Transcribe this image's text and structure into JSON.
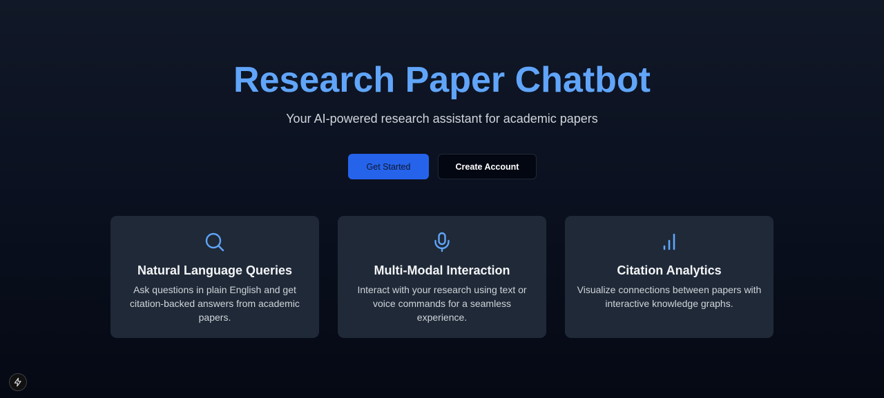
{
  "hero": {
    "title": "Research Paper Chatbot",
    "subtitle": "Your AI-powered research assistant for academic papers"
  },
  "actions": {
    "primary_label": "Get Started",
    "secondary_label": "Create Account"
  },
  "features": [
    {
      "icon": "search-icon",
      "title": "Natural Language Queries",
      "description": "Ask questions in plain English and get citation-backed answers from academic papers."
    },
    {
      "icon": "microphone-icon",
      "title": "Multi-Modal Interaction",
      "description": "Interact with your research using text or voice commands for a seamless experience."
    },
    {
      "icon": "bar-chart-icon",
      "title": "Citation Analytics",
      "description": "Visualize connections between papers with interactive knowledge graphs."
    }
  ],
  "dev_badge": {
    "icon": "lightning-icon"
  },
  "colors": {
    "accent": "#60a5fa",
    "primary_button": "#2563eb",
    "card_background": "#1f2937",
    "page_background": "#0b1120"
  }
}
